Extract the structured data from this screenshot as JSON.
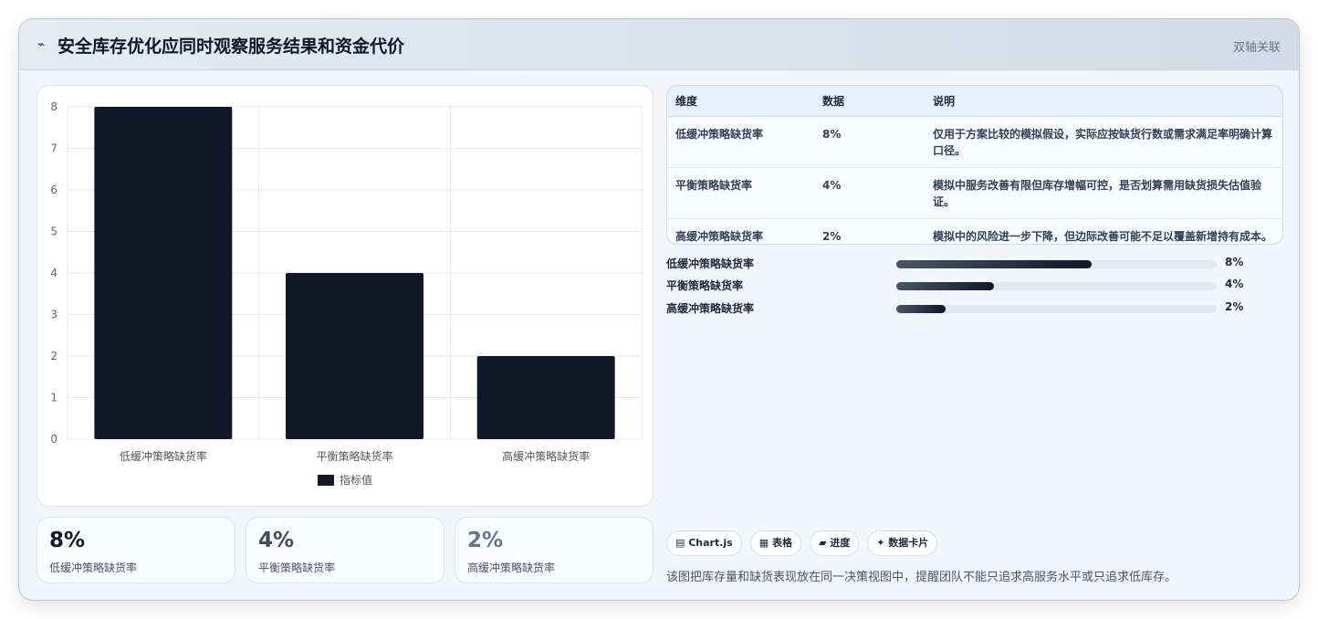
{
  "header": {
    "icon": "chart-line-icon",
    "title": "安全库存优化应同时观察服务结果和资金代价",
    "link": "双轴关联"
  },
  "chart_data": {
    "type": "bar",
    "categories": [
      "低缓冲策略缺货率",
      "平衡策略缺货率",
      "高缓冲策略缺货率"
    ],
    "series": [
      {
        "name": "指标值",
        "values": [
          8,
          4,
          2
        ],
        "color": "#111827"
      }
    ],
    "ylim": [
      0,
      8
    ],
    "yticks": [
      0,
      1,
      2,
      3,
      4,
      5,
      6,
      7,
      8
    ],
    "grid": true,
    "legend": "bottom"
  },
  "stats": [
    {
      "value": "8%",
      "label": "低缓冲策略缺货率",
      "color": "#0f172a"
    },
    {
      "value": "4%",
      "label": "平衡策略缺货率",
      "color": "#3f4b5e"
    },
    {
      "value": "2%",
      "label": "高缓冲策略缺货率",
      "color": "#64748b"
    }
  ],
  "table": {
    "headers": [
      "维度",
      "数据",
      "说明"
    ],
    "rows": [
      [
        "低缓冲策略缺货率",
        "8%",
        "仅用于方案比较的模拟假设，实际应按缺货行数或需求满足率明确计算口径。"
      ],
      [
        "平衡策略缺货率",
        "4%",
        "模拟中服务改善有限但库存增幅可控，是否划算需用缺货损失估值验证。"
      ],
      [
        "高缓冲策略缺货率",
        "2%",
        "模拟中的风险进一步下降，但边际改善可能不足以覆盖新增持有成本。"
      ]
    ]
  },
  "progress": [
    {
      "label": "低缓冲策略缺货率",
      "value": "8%",
      "fraction": 0.61
    },
    {
      "label": "平衡策略缺货率",
      "value": "4%",
      "fraction": 0.305
    },
    {
      "label": "高缓冲策略缺货率",
      "value": "2%",
      "fraction": 0.155
    }
  ],
  "tags": [
    "▤ Chart.js",
    "▦ 表格",
    "▰ 进度",
    "✦ 数据卡片"
  ],
  "note": "该图把库存量和缺货表现放在同一决策视图中，提醒团队不能只追求高服务水平或只追求低库存。"
}
